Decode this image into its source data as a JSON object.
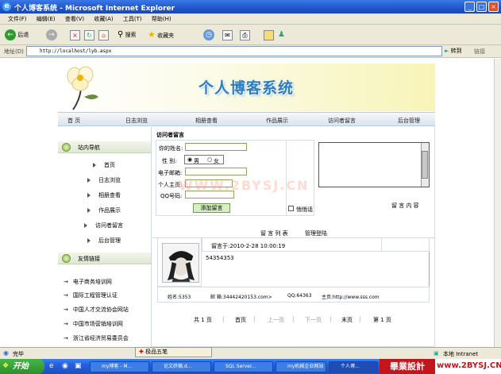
{
  "window": {
    "title": "个人博客系统 - Microsoft Internet Explorer",
    "controls": [
      "_",
      "□",
      "×"
    ]
  },
  "menu": [
    "文件(F)",
    "编辑(E)",
    "查看(V)",
    "收藏(A)",
    "工具(T)",
    "帮助(H)"
  ],
  "toolbar": {
    "back": "后退",
    "search": "搜索",
    "favorites": "收藏夹"
  },
  "address": {
    "label": "地址(D)",
    "url": "http://localhost/lyb.aspx",
    "go": "转到",
    "links": "链接"
  },
  "site": {
    "title": "个人博客系统",
    "nav": [
      "首 页",
      "日志浏览",
      "相册查看",
      "作品展示",
      "访问者留言",
      "后台管理"
    ]
  },
  "sidebar": {
    "nav_header": "站内导航",
    "nav_items": [
      "首页",
      "日志浏览",
      "相册查看",
      "作品展示",
      "访问者留言",
      "后台管理"
    ],
    "links_header": "友情链接",
    "friend_links": [
      "电子商务培训网",
      "国际工程管理认证",
      "中国人才交流协会网站",
      "中国市场营销培训网",
      "浙江省经济贸易委员会"
    ]
  },
  "form": {
    "title": "访问者留言",
    "name_label": "你的姓名:",
    "gender_label": "性  别:",
    "gender_male": "男",
    "gender_female": "女",
    "email_label": "电子邮箱:",
    "homepage_label": "个人主页:",
    "qq_label": "QQ号码:",
    "submit": "添加留言",
    "whisper": "悄悄话",
    "content_label": "留 言 内 容"
  },
  "watermark": "WWW.2BYSJ.CN",
  "list": {
    "tab_list": "留 言 列 表",
    "tab_manage": "管理登陆"
  },
  "message": {
    "time": "留言于:2010-2-28 10:00:19",
    "content": "54354353",
    "name": "姓名:5353",
    "email": "邮  箱:34442420153.com>",
    "qq": "QQ:64363",
    "homepage": "主页:http://www.sss.com"
  },
  "pager": {
    "total": "共 1 页",
    "first": "首页",
    "prev": "上一页",
    "next": "下一页",
    "last": "末页",
    "current": "第 1 页"
  },
  "status": {
    "left": "完毕",
    "zone": "本地 Intranet"
  },
  "ime": "极品五笔",
  "taskbar": {
    "start": "开始",
    "tasks": [
      "my博客 - M...",
      "论文终稿.d...",
      "SQL Server...",
      "my机械企业网站",
      "个人博..."
    ],
    "brand": "畢業設計",
    "brand_url": "www.2BYSJ.CN"
  }
}
